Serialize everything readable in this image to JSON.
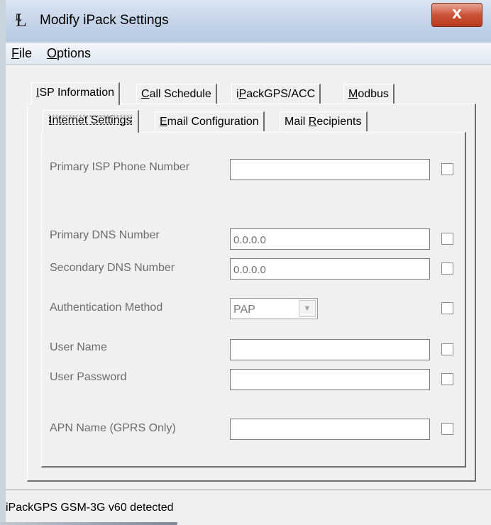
{
  "window": {
    "title": "Modify iPack Settings",
    "close_glyph": "X"
  },
  "menubar": {
    "items": [
      {
        "label": "File",
        "mnemonic": "F",
        "rest": "ile"
      },
      {
        "label": "Options",
        "mnemonic": "O",
        "rest": "ptions"
      }
    ]
  },
  "outer_tabs": [
    {
      "mnemonic": "I",
      "rest": "SP Information"
    },
    {
      "mnemonic": "C",
      "rest": "all Schedule"
    },
    {
      "pre": "i",
      "mnemonic": "P",
      "rest": "ackGPS/ACC"
    },
    {
      "mnemonic": "M",
      "rest": "odbus"
    }
  ],
  "inner_tabs": [
    {
      "mnemonic": "I",
      "rest": "nternet Settings"
    },
    {
      "mnemonic": "E",
      "rest": "mail Configuration"
    },
    {
      "pre": "Mail ",
      "mnemonic": "R",
      "rest": "ecipients"
    }
  ],
  "form": {
    "primary_isp_label": "Primary ISP Phone Number",
    "primary_isp_value": "",
    "primary_dns_label": "Primary DNS Number",
    "primary_dns_value": "0.0.0.0",
    "secondary_dns_label": "Secondary DNS Number",
    "secondary_dns_value": "0.0.0.0",
    "auth_label": "Authentication Method",
    "auth_value": "PAP",
    "user_name_label": "User Name",
    "user_name_value": "",
    "user_password_label": "User Password",
    "user_password_value": "",
    "apn_label": "APN Name (GPRS Only)",
    "apn_value": ""
  },
  "status": {
    "text": "iPackGPS GSM-3G v60 detected"
  },
  "icons": {
    "app": "antenna-icon",
    "dropdown": "chevron-down-icon"
  }
}
